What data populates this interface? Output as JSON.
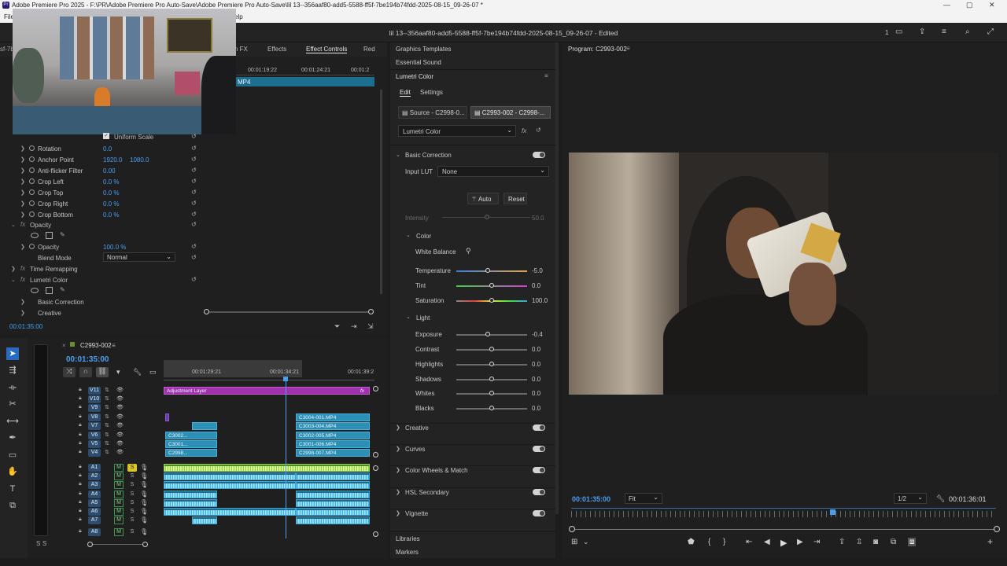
{
  "window": {
    "title": "Adobe Premiere Pro 2025 - F:\\PR\\Adobe Premiere Pro Auto-Save\\Adobe Premiere Pro Auto-Save\\lil 13--356aaf80-add5-5588-ff5f-7be194b74fdd-2025-08-15_09-26-07 *",
    "minimize": "—",
    "maximize": "▢",
    "close": "✕"
  },
  "menu": {
    "file": "File",
    "help": "elp"
  },
  "header": {
    "project_title": "lil 13--356aaf80-add5-5588-ff5f-7be194b74fdd-2025-08-15_09-26-07 - Edited",
    "count": "1"
  },
  "left_tabs": {
    "cut_label": "sf-7b",
    "fx": "n FX",
    "effects": "Effects",
    "effect_controls": "Effect Controls",
    "red": "Red"
  },
  "effect_controls": {
    "clip_label": "MP4",
    "ruler": [
      "00:01:19:22",
      "00:01:24:21",
      "00:01:2"
    ],
    "uniform_scale": "Uniform Scale",
    "rows": [
      {
        "label": "Rotation",
        "v1": "0.0",
        "v2": ""
      },
      {
        "label": "Anchor Point",
        "v1": "1920.0",
        "v2": "1080.0"
      },
      {
        "label": "Anti-flicker Filter",
        "v1": "0.00",
        "v2": ""
      },
      {
        "label": "Crop Left",
        "v1": "0.0 %",
        "v2": ""
      },
      {
        "label": "Crop Top",
        "v1": "0.0 %",
        "v2": ""
      },
      {
        "label": "Crop Right",
        "v1": "0.0 %",
        "v2": ""
      },
      {
        "label": "Crop Bottom",
        "v1": "0.0 %",
        "v2": ""
      }
    ],
    "opacity_section": "Opacity",
    "opacity_label": "Opacity",
    "opacity_value": "100.0 %",
    "blend_mode_label": "Blend Mode",
    "blend_mode_value": "Normal",
    "time_remapping": "Time Remapping",
    "lumetri_color": "Lumetri Color",
    "basic_correction": "Basic Correction",
    "creative": "Creative",
    "timecode": "00:01:35:00"
  },
  "timeline": {
    "sequence_name": "C2993-002",
    "timecode": "00:01:35:00",
    "ruler": [
      "00:01:29:21",
      "00:01:34:21",
      "00:01:39:2"
    ],
    "video_tracks": [
      "V11",
      "V10",
      "V9",
      "V8",
      "V7",
      "V6",
      "V5",
      "V4"
    ],
    "audio_tracks": [
      "A1",
      "A2",
      "A3",
      "A4",
      "A5",
      "A6",
      "A7",
      "A8"
    ],
    "adjustment_layer": "Adjustment Layer",
    "clips_right": [
      "C3004-001.MP4",
      "C3003-004.MP4",
      "C3002-005.MP4",
      "C3001-006.MP4",
      "C2998-007.MP4"
    ],
    "clips_left": [
      "C3002...",
      "C3001...",
      "C2998..."
    ],
    "m_label": "M",
    "s_label": "S",
    "fx": "fx",
    "meter_labels": [
      "S",
      "S"
    ]
  },
  "lumetri": {
    "tabs": [
      "Graphics Templates",
      "Essential Sound"
    ],
    "panel_title": "Lumetri Color",
    "edit_tab": "Edit",
    "settings_tab": "Settings",
    "source_tab": "Source - C2998-0...",
    "seq_tab": "C2993-002 - C2998-...",
    "effect_select": "Lumetri Color",
    "basic_correction": "Basic Correction",
    "input_lut_label": "Input LUT",
    "input_lut_value": "None",
    "auto_button": "Auto",
    "reset_button": "Reset",
    "intensity_label": "Intensity",
    "intensity_value": "50.0",
    "color_section": "Color",
    "white_balance": "White Balance",
    "sliders": [
      {
        "label": "Temperature",
        "value": "-5.0",
        "pos": 0.44
      },
      {
        "label": "Tint",
        "value": "0.0",
        "pos": 0.5
      },
      {
        "label": "Saturation",
        "value": "100.0",
        "pos": 0.5
      },
      {
        "label": "Exposure",
        "value": "-0.4",
        "pos": 0.44
      },
      {
        "label": "Contrast",
        "value": "0.0",
        "pos": 0.5
      },
      {
        "label": "Highlights",
        "value": "0.0",
        "pos": 0.5
      },
      {
        "label": "Shadows",
        "value": "0.0",
        "pos": 0.5
      },
      {
        "label": "Whites",
        "value": "0.0",
        "pos": 0.5
      },
      {
        "label": "Blacks",
        "value": "0.0",
        "pos": 0.5
      }
    ],
    "light_section": "Light",
    "sections": [
      "Creative",
      "Curves",
      "Color Wheels & Match",
      "HSL Secondary",
      "Vignette"
    ],
    "libraries": "Libraries",
    "markers": "Markers"
  },
  "program": {
    "title": "Program: C2993-002",
    "timecode": "00:01:35:00",
    "fit": "Fit",
    "resolution": "1/2",
    "duration": "00:01:36:01",
    "playhead_fraction": 0.98
  }
}
